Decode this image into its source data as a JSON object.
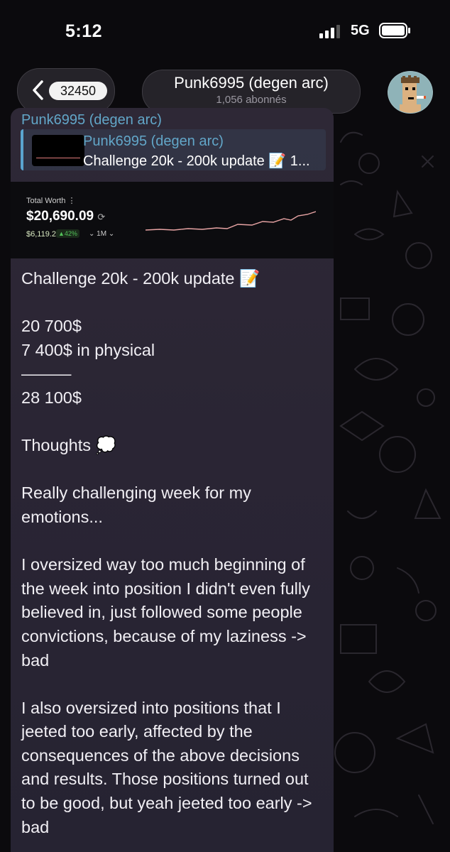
{
  "status_bar": {
    "time": "5:12",
    "network": "5G",
    "signal_bars": 3,
    "icons": [
      "signal-icon",
      "battery-icon"
    ]
  },
  "header": {
    "back_count": "32450",
    "channel_name": "Punk6995 (degen arc)",
    "subscribers": "1,056 abonnés",
    "icons": [
      "chevron-left-icon",
      "punk-avatar-icon"
    ]
  },
  "message": {
    "sender": "Punk6995 (degen arc)",
    "reply": {
      "name": "Punk6995 (degen arc)",
      "text": "Challenge 20k - 200k update 📝 1..."
    },
    "preview": {
      "label": "Total Worth ⋮",
      "value": "$20,690.09",
      "sub_value": "$6,119.2",
      "change": "▲42%",
      "range": "⌄  1M ⌄"
    },
    "text": "Challenge 20k - 200k update 📝\n\n20 700$\n7 400$ in physical\n———\n28 100$\n\nThoughts 💭\n\nReally challenging week for my emotions...\n\nI oversized way too much beginning of the week into position I didn't even fully believed in, just followed some people convictions, because of my laziness -> bad\n\nI also oversized into positions that I jeeted too early, affected by the consequences of the above decisions and results. Those positions turned out to be good, but yeah jeeted too early -> bad"
  },
  "colors": {
    "background": "#0b0a0d",
    "bubble": "#2b2635",
    "link_blue": "#62a6c8",
    "text": "#f1eff4"
  }
}
